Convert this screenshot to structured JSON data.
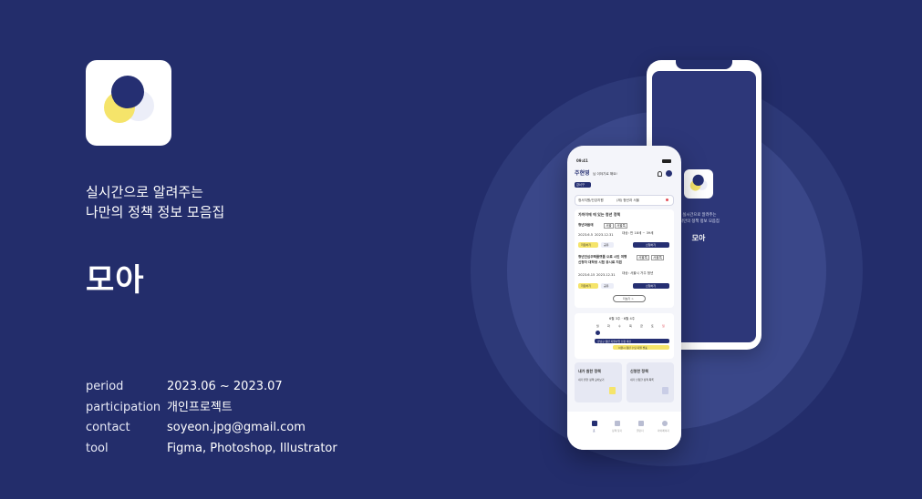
{
  "project": {
    "tagline_line1": "실시간으로 알려주는",
    "tagline_line2": "나만의 정책 정보 모음집",
    "app_name": "모아",
    "info": [
      {
        "key": "period",
        "value": "2023.06 ~ 2023.07"
      },
      {
        "key": "participation",
        "value": "개인프로젝트"
      },
      {
        "key": "contact",
        "value": "soyeon.jpg@gmail.com"
      },
      {
        "key": "tool",
        "value": "Figma, Photoshop, Illustrator"
      }
    ]
  },
  "colors": {
    "background": "#232d6b",
    "navy": "#252f72",
    "yellow": "#f5e46a",
    "lavender": "#eceef8"
  },
  "splash": {
    "line1": "실시간으로 알려주는",
    "line2": "나만의 정책 정보 모음집",
    "name": "모아"
  },
  "mockup": {
    "status_time": "09:41",
    "user_name": "주현영",
    "user_suffix": "님 이야기로 해요!",
    "location_chip": "강서구",
    "filter_left": "정서지원/건강지원",
    "filter_right": "(제) 청년과 서울",
    "section_title": "가까이에 에 있는 청년 정책",
    "policy1_title": "청년마음애",
    "policy1_tag1": "서울",
    "policy1_tag2": "서울특",
    "policy1_date": "2023.6.5",
    "policy1_date2": "2023.12.31",
    "policy1_meta": "대상: 만 18세 ~ 39세",
    "policy2_title": "청년안심주택플랫폼 으로 시민 여행",
    "policy2_title2": "신청자 대학생 시험 응시료 지원",
    "policy2_tag1": "서울특",
    "policy2_tag2": "서울특",
    "policy2_date": "2023.6.15",
    "policy2_date2": "2023.12.31",
    "policy2_meta": "대상: 서울시 거주 청년",
    "policy_save": "저장하기",
    "policy_share": "공유",
    "policy_apply": "신청하기",
    "more_button": "더보기 >",
    "calendar_month": "6월 3주 · 6월 4주",
    "weekdays": [
      "월",
      "화",
      "수",
      "목",
      "금",
      "토",
      "일"
    ],
    "calendar_bar": "강남구 청년 지원사업 신청 마감",
    "calendar_bar2": "서울시 청년 수당 지원 발표",
    "card1_title": "내가 원한 정책",
    "card1_sub": "내가 원한 정책 모아보기",
    "card2_title": "신청한 정책",
    "card2_sub": "내가 신청한 정책 목록",
    "nav": [
      {
        "label": "홈"
      },
      {
        "label": "정책 찾기"
      },
      {
        "label": "캘린더"
      },
      {
        "label": "마이페이지"
      }
    ]
  }
}
